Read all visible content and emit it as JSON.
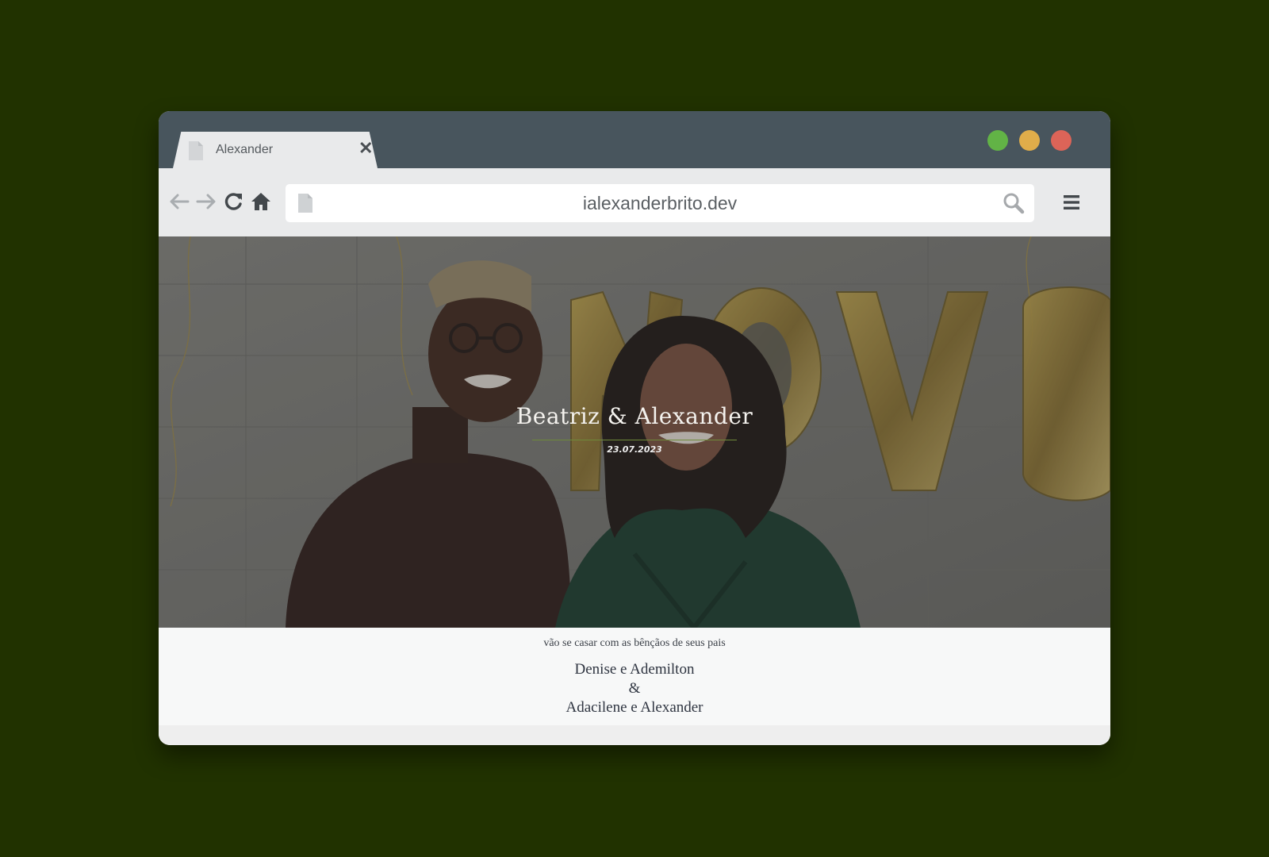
{
  "browser": {
    "tab": {
      "title": "Alexander",
      "icon": "document-icon",
      "close_icon": "close-icon"
    },
    "window_controls": [
      {
        "name": "maximize",
        "color": "#62b346"
      },
      {
        "name": "minimize",
        "color": "#e0ad4a"
      },
      {
        "name": "close",
        "color": "#dc6458"
      }
    ],
    "nav": {
      "back_icon": "arrow-left-icon",
      "forward_icon": "arrow-right-icon",
      "reload_icon": "reload-icon",
      "home_icon": "home-icon"
    },
    "address_bar": {
      "url": "ialexanderbrito.dev",
      "search_icon": "search-icon",
      "page_icon": "document-icon"
    },
    "menu_icon": "hamburger-menu-icon"
  },
  "page": {
    "hero": {
      "title": "Beatriz & Alexander",
      "date": "23.07.2023",
      "balloon_text": "NOVO"
    },
    "blessing": "vão se casar com as bênçãos de seus pais",
    "parents": {
      "first": "Denise e Ademilton",
      "separator": "&",
      "second": "Adacilene e Alexander"
    }
  },
  "colors": {
    "background": "#213200",
    "titlebar": "#48555d",
    "toolbar": "#e9eaeb",
    "accent_rule": "#6f8a3a"
  }
}
